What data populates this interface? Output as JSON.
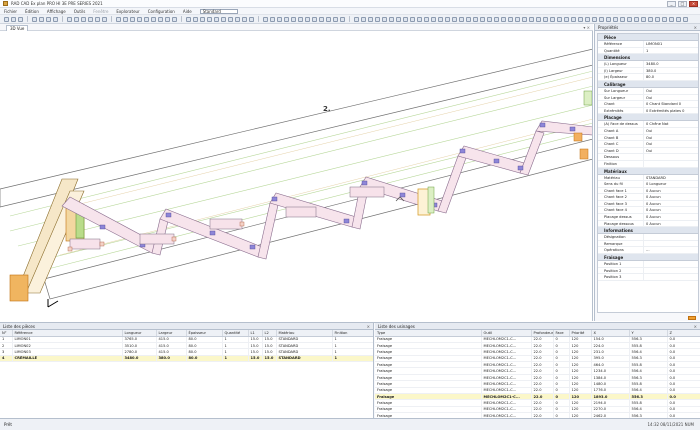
{
  "app": {
    "title": "RAD CAD Ex plan PRO HI 3E PRE SERIES 2021",
    "window_buttons": {
      "minimize": "_",
      "maximize": "□",
      "close": "×"
    }
  },
  "menu": {
    "items": [
      "Fichier",
      "Édition",
      "Affichage",
      "Outils",
      "Fenêtre",
      "Explorateur",
      "Configuration",
      "Aide"
    ],
    "disabled_index": 4,
    "combo_value": "Standard"
  },
  "viewport": {
    "tab_label": "3D Vue",
    "panel_controls": "▾ × ",
    "annotation_label": "2."
  },
  "properties": {
    "title": "Propriétés",
    "close_glyph": "×",
    "sections": [
      {
        "name": "Pièce",
        "rows": [
          {
            "k": "Référence",
            "v": "LIMON01"
          },
          {
            "k": "Quantité",
            "v": "1"
          }
        ]
      },
      {
        "name": "Dimensions",
        "rows": [
          {
            "k": "(L) Longueur",
            "v": "3480.0"
          },
          {
            "k": "(l) Largeur",
            "v": "380.0"
          },
          {
            "k": "(e) Épaisseur",
            "v": "80.0"
          }
        ]
      },
      {
        "name": "Calibrage",
        "rows": [
          {
            "k": "Sur Longueur",
            "v": "Oui"
          },
          {
            "k": "Sur Largeur",
            "v": "Oui"
          },
          {
            "k": "Chant",
            "v": "0  Chant Standard 0"
          },
          {
            "k": "Extrémités",
            "v": "0  Extrémités plates 0"
          }
        ]
      },
      {
        "name": "Placage",
        "rows": [
          {
            "k": "(A) Face de dessus",
            "v": "0  Chêne Nat"
          },
          {
            "k": "Chant A",
            "v": "Oui"
          },
          {
            "k": "Chant B",
            "v": "Oui"
          },
          {
            "k": "Chant C",
            "v": "Oui"
          },
          {
            "k": "Chant D",
            "v": "Oui"
          },
          {
            "k": "Dessous",
            "v": ""
          },
          {
            "k": "Finition",
            "v": ""
          }
        ]
      },
      {
        "name": "Matériaux",
        "rows": [
          {
            "k": "Matériau",
            "v": "STANDARD"
          },
          {
            "k": "Sens du fil",
            "v": "0  Longueur"
          },
          {
            "k": "Chant face 1",
            "v": "0  Aucun"
          },
          {
            "k": "Chant face 2",
            "v": "0  Aucun"
          },
          {
            "k": "Chant face 3",
            "v": "0  Aucun"
          },
          {
            "k": "Chant face 4",
            "v": "0  Aucun"
          },
          {
            "k": "Placage dessus",
            "v": "0  Aucun"
          },
          {
            "k": "Placage dessous",
            "v": "0  Aucun"
          }
        ]
      },
      {
        "name": "Informations",
        "rows": [
          {
            "k": "Désignation",
            "v": ""
          },
          {
            "k": "Remarque",
            "v": ""
          },
          {
            "k": "Opérations",
            "v": "…"
          }
        ]
      },
      {
        "name": "Fraisage",
        "rows": [
          {
            "k": "Position 1",
            "v": ""
          },
          {
            "k": "Position 2",
            "v": ""
          },
          {
            "k": "Position 3",
            "v": ""
          }
        ]
      }
    ]
  },
  "parts_list": {
    "title": "Liste des pièces",
    "close_glyph": "×",
    "columns": [
      "N°",
      "Référence",
      "Longueur",
      "Largeur",
      "Épaisseur",
      "Quantité",
      "L1",
      "L2",
      "Matériau",
      "Finition"
    ],
    "rows": [
      [
        "1",
        "LIMON01",
        "3765.0",
        "415.0",
        "80.0",
        "1",
        "15.0",
        "15.0",
        "STANDARD",
        "1"
      ],
      [
        "2",
        "LIMON02",
        "3510.0",
        "415.0",
        "80.0",
        "1",
        "15.0",
        "15.0",
        "STANDARD",
        "1"
      ],
      [
        "3",
        "LIMON03",
        "2780.0",
        "415.0",
        "80.0",
        "1",
        "15.0",
        "15.0",
        "STANDARD",
        "1"
      ],
      [
        "4",
        "CRÉMAILLÈ",
        "3480.0",
        "380.0",
        "80.0",
        "1",
        "15.0",
        "15.0",
        "STANDARD",
        "1"
      ]
    ],
    "selected_row": 3
  },
  "machining_list": {
    "title": "Liste des usinages",
    "close_glyph": "×",
    "columns": [
      "Type",
      "Outil",
      "Profondeur",
      "Face",
      "Priorité",
      "X",
      "Y",
      "Z"
    ],
    "rows": [
      [
        "Fraisage",
        "MECHLOM2C1-C...",
        "22.0",
        "0",
        "120",
        "154.0",
        "556.3",
        "0.0"
      ],
      [
        "Fraisage",
        "MECHLOM2C1-C...",
        "22.0",
        "0",
        "120",
        "224.0",
        "555.8",
        "0.0"
      ],
      [
        "Fraisage",
        "MECHLOM2C1-C...",
        "22.0",
        "0",
        "120",
        "231.0",
        "556.4",
        "0.0"
      ],
      [
        "Fraisage",
        "MECHLOM2C1-C...",
        "22.0",
        "0",
        "120",
        "395.0",
        "556.3",
        "0.0"
      ],
      [
        "Fraisage",
        "MECHLOM2C1-C...",
        "22.0",
        "0",
        "120",
        "464.0",
        "555.8",
        "0.0"
      ],
      [
        "Fraisage",
        "MECHLOM2C1-C...",
        "22.0",
        "0",
        "120",
        "1234.0",
        "556.4",
        "0.0"
      ],
      [
        "Fraisage",
        "MECHLOM2C1-C...",
        "22.0",
        "0",
        "120",
        "1384.0",
        "556.3",
        "0.0"
      ],
      [
        "Fraisage",
        "MECHLOM2C1-C...",
        "22.0",
        "0",
        "120",
        "1480.0",
        "555.8",
        "0.0"
      ],
      [
        "Fraisage",
        "MECHLOM2C1-C...",
        "22.0",
        "0",
        "120",
        "1776.0",
        "556.4",
        "0.0"
      ],
      [
        "Fraisage",
        "MECHLOM2C1-C...",
        "22.0",
        "0",
        "120",
        "1893.0",
        "556.3",
        "0.0"
      ],
      [
        "Fraisage",
        "MECHLOM2C1-C...",
        "22.0",
        "0",
        "120",
        "2194.0",
        "555.8",
        "0.0"
      ],
      [
        "Fraisage",
        "MECHLOM2C1-C...",
        "22.0",
        "0",
        "120",
        "2270.0",
        "556.4",
        "0.0"
      ],
      [
        "Fraisage",
        "MECHLOM2C1-C...",
        "22.0",
        "0",
        "120",
        "2462.0",
        "556.3",
        "0.0"
      ]
    ],
    "selected_row": 9
  },
  "status": {
    "left": "Prêt",
    "right": "14:32  08/11/2021  NUM"
  }
}
